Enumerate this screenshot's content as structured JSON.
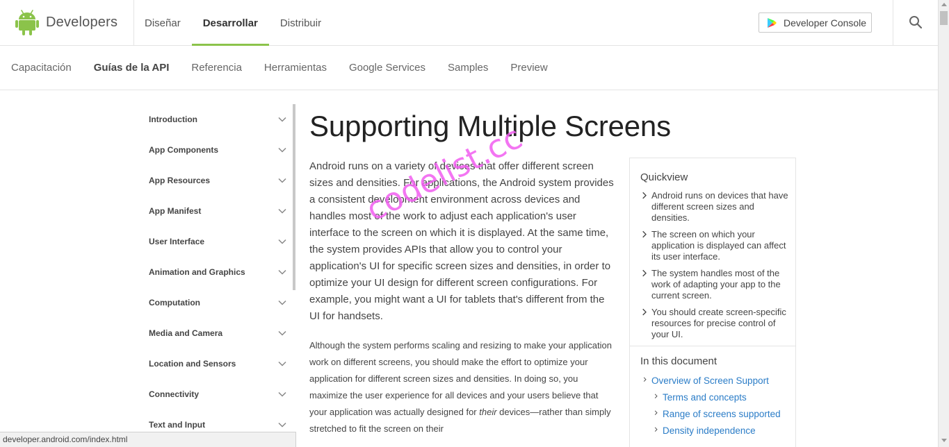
{
  "header": {
    "logo_text": "Developers",
    "nav": [
      {
        "label": "Diseñar",
        "active": false
      },
      {
        "label": "Desarrollar",
        "active": true
      },
      {
        "label": "Distribuir",
        "active": false
      }
    ],
    "console_button": "Developer Console",
    "accent_color": "#8bc34a"
  },
  "subnav": [
    {
      "label": "Capacitación",
      "active": false
    },
    {
      "label": "Guías de la API",
      "active": true
    },
    {
      "label": "Referencia",
      "active": false
    },
    {
      "label": "Herramientas",
      "active": false
    },
    {
      "label": "Google Services",
      "active": false
    },
    {
      "label": "Samples",
      "active": false
    },
    {
      "label": "Preview",
      "active": false
    }
  ],
  "sidebar": {
    "items": [
      {
        "label": "Introduction"
      },
      {
        "label": "App Components"
      },
      {
        "label": "App Resources"
      },
      {
        "label": "App Manifest"
      },
      {
        "label": "User Interface"
      },
      {
        "label": "Animation and Graphics"
      },
      {
        "label": "Computation"
      },
      {
        "label": "Media and Camera"
      },
      {
        "label": "Location and Sensors"
      },
      {
        "label": "Connectivity"
      },
      {
        "label": "Text and Input"
      }
    ]
  },
  "main": {
    "title": "Supporting Multiple Screens",
    "intro": "Android runs on a variety of devices that offer different screen sizes and densities. For applications, the Android system provides a consistent development environment across devices and handles most of the work to adjust each application's user interface to the screen on which it is displayed. At the same time, the system provides APIs that allow you to control your application's UI for specific screen sizes and densities, in order to optimize your UI design for different screen configurations. For example, you might want a UI for tablets that's different from the UI for handsets.",
    "para_before_em": "Although the system performs scaling and resizing to make your application work on different screens, you should make the effort to optimize your application for different screen sizes and densities. In doing so, you maximize the user experience for all devices and your users believe that your application was actually designed for ",
    "para_em": "their",
    "para_after_em": " devices—rather than simply stretched to fit the screen on their"
  },
  "quickview": {
    "heading": "Quickview",
    "items": [
      "Android runs on devices that have different screen sizes and densities.",
      "The screen on which your application is displayed can affect its user interface.",
      "The system handles most of the work of adapting your app to the current screen.",
      "You should create screen-specific resources for precise control of your UI."
    ],
    "doc_heading": "In this document",
    "doc_links": [
      {
        "label": "Overview of Screen Support",
        "level": 1
      },
      {
        "label": "Terms and concepts",
        "level": 2
      },
      {
        "label": "Range of screens supported",
        "level": 2
      },
      {
        "label": "Density independence",
        "level": 2
      }
    ],
    "link_color": "#2a7cc7"
  },
  "statusbar": {
    "url": "developer.android.com/index.html"
  },
  "watermark": "codelist.cc"
}
